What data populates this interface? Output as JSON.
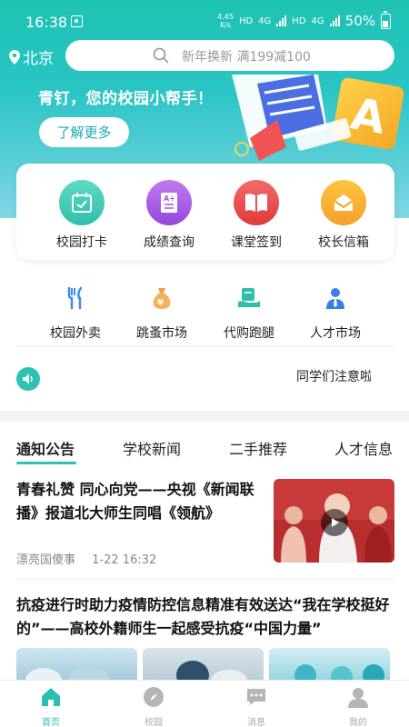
{
  "status_bar": {
    "time": "16:38",
    "speed_value": "4.45",
    "speed_unit": "K/s",
    "hd1": "HD",
    "net1": "4G",
    "hd2": "HD",
    "net2": "4G",
    "battery": "50%"
  },
  "header": {
    "location": "北京",
    "search_placeholder": "新年换新 满199减100"
  },
  "banner": {
    "slogan": "青钉，您的校园小帮手！",
    "button_label": "了解更多",
    "art_letter": "A"
  },
  "main_grid": [
    {
      "label": "校园打卡",
      "icon": "calendar-check-icon",
      "color": "#35c9b0"
    },
    {
      "label": "成绩查询",
      "icon": "grade-report-icon",
      "color": "#a35be2"
    },
    {
      "label": "课堂签到",
      "icon": "book-icon",
      "color": "#ea4a4a"
    },
    {
      "label": "校长信箱",
      "icon": "mail-icon",
      "color": "#f5a623"
    }
  ],
  "sub_grid": [
    {
      "label": "校园外卖",
      "icon": "fork-knife-icon"
    },
    {
      "label": "跳蚤市场",
      "icon": "money-bag-icon"
    },
    {
      "label": "代购跑腿",
      "icon": "delivery-icon"
    },
    {
      "label": "人才市场",
      "icon": "person-icon"
    }
  ],
  "notice": {
    "text": "同学们注意啦"
  },
  "tabs": [
    {
      "label": "通知公告",
      "active": true
    },
    {
      "label": "学校新闻",
      "active": false
    },
    {
      "label": "二手推荐",
      "active": false
    },
    {
      "label": "人才信息",
      "active": false
    }
  ],
  "articles": [
    {
      "title": "青春礼赞 同心向党——央视《新闻联播》报道北大师生同唱《领航》",
      "source": "漂亮国傻事",
      "time": "1-22 16:32"
    },
    {
      "title": "抗疫进行时助力疫情防控信息精准有效送达“我在学校挺好的”——高校外籍师生一起感受抗疫“中国力量”"
    }
  ],
  "bottom_nav": [
    {
      "label": "首页",
      "icon": "home-icon",
      "active": true
    },
    {
      "label": "校园",
      "icon": "compass-icon",
      "active": false
    },
    {
      "label": "消息",
      "icon": "message-icon",
      "active": false
    },
    {
      "label": "我的",
      "icon": "user-icon",
      "active": false
    }
  ],
  "colors": {
    "accent": "#29c4b6",
    "header_top": "#1ec3b2"
  }
}
